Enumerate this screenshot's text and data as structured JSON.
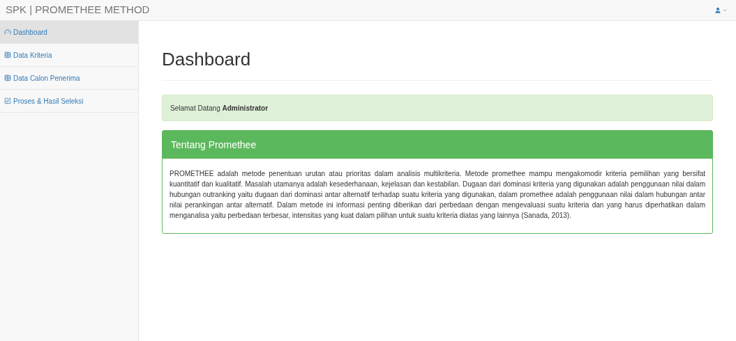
{
  "navbar": {
    "brand": "SPK | PROMETHEE METHOD"
  },
  "sidebar": {
    "items": [
      {
        "label": "Dashboard",
        "selected": true
      },
      {
        "label": "Data Kriteria",
        "selected": false
      },
      {
        "label": "Data Calon Penerima",
        "selected": false
      },
      {
        "label": "Proses & Hasil Seleksi",
        "selected": false
      }
    ]
  },
  "page": {
    "title": "Dashboard"
  },
  "alert": {
    "text": "Selamat Datang **Administrator**"
  },
  "panel": {
    "heading": "Tentang Promethee",
    "body": "PROMETHEE adalah metode penentuan urutan atau prioritas dalam analisis multikriteria. Metode promethee mampu mengakomodir kriteria pemilihan yang bersifat kuantitatif dan kualitatif. Masalah utamanya adalah kesederhanaan, kejelasan dan kestabilan. Dugaan dari dominasi kriteria yang digunakan adalah penggunaan nilai dalam hubungan outranking yaitu dugaan dari dominasi antar alternatif terhadap suatu kriteria yang digunakan, dalam promethee adalah penggunaan nilai dalam hubungan antar nilai perankingan antar alternatif. Dalam metode ini informasi penting diberikan dari perbedaan dengan mengevaluasi suatu kriteria dan yang harus diperhatikan dalam menganalisa yaitu perbedaan terbesar, intensitas yang kuat dalam pilihan untuk suatu kriteria diatas yang lainnya (Sanada, 2013)."
  }
}
